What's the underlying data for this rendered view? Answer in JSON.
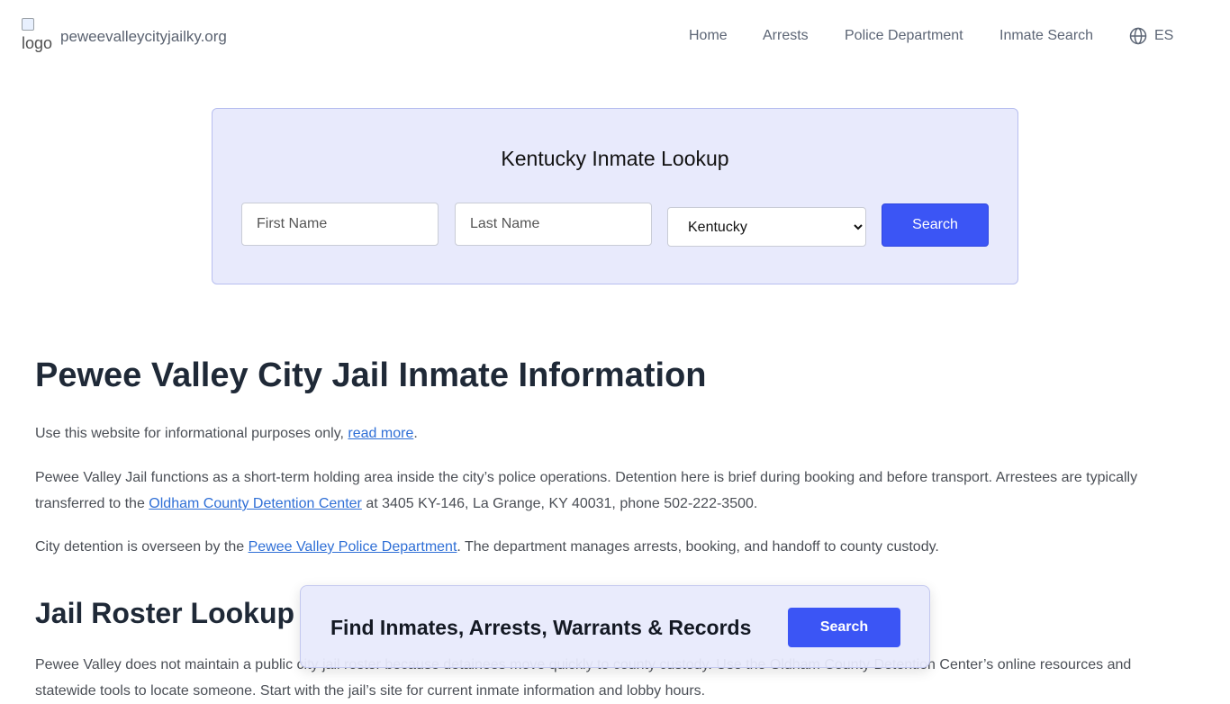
{
  "header": {
    "logo_alt": "logo",
    "site_name": "peweevalleycityjailky.org",
    "nav": [
      "Home",
      "Arrests",
      "Police Department",
      "Inmate Search"
    ],
    "lang": "ES"
  },
  "lookup": {
    "title": "Kentucky Inmate Lookup",
    "first_name_placeholder": "First Name",
    "last_name_placeholder": "Last Name",
    "state_selected": "Kentucky",
    "search_label": "Search"
  },
  "main": {
    "title": "Pewee Valley City Jail Inmate Information",
    "intro_text": "Use this website for informational purposes only, ",
    "intro_link": "read more",
    "intro_end": ".",
    "p1_a": "Pewee Valley Jail functions as a short-term holding area inside the city’s police operations. Detention here is brief during booking and before transport. Arrestees are typically transferred to the ",
    "p1_link": "Oldham County Detention Center",
    "p1_b": " at 3405 KY-146, La Grange, KY 40031, phone 502-222-3500.",
    "p2_a": "City detention is overseen by the ",
    "p2_link": "Pewee Valley Police Department",
    "p2_b": ". The department manages arrests, booking, and handoff to county custody.",
    "h2": "Jail Roster Lookup",
    "p3": "Pewee Valley does not maintain a public city jail roster because detainees move quickly to county custody. Use the Oldham County Detention Center’s online resources and statewide tools to locate someone. Start with the jail’s site for current inmate information and lobby hours."
  },
  "sticky": {
    "text": "Find Inmates, Arrests, Warrants & Records",
    "button": "Search"
  }
}
